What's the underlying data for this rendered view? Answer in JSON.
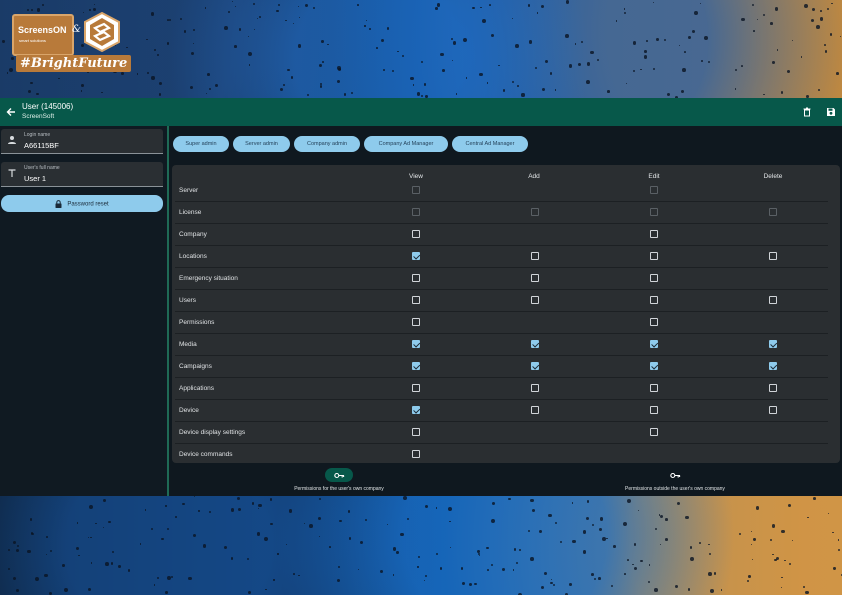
{
  "logo": {
    "brand": "ScreensON",
    "brand_sub": "smart solutions",
    "ampersand": "&",
    "tagline": "#BrightFuture"
  },
  "appbar": {
    "title": "User (145006)",
    "subtitle": "ScreenSoft"
  },
  "sidebar": {
    "login": {
      "label": "Login name",
      "value": "A66115BF"
    },
    "fullname": {
      "label": "User's full name",
      "value": "User 1"
    },
    "password_reset": "Password reset"
  },
  "roles": [
    "Super admin",
    "Server admin",
    "Company admin",
    "Company Ad Manager",
    "Central Ad Manager"
  ],
  "table": {
    "columns": [
      "View",
      "Add",
      "Edit",
      "Delete"
    ],
    "rows": [
      {
        "label": "Server",
        "cells": [
          "disabled",
          "none",
          "disabled",
          "none"
        ]
      },
      {
        "label": "License",
        "cells": [
          "disabled",
          "disabled",
          "disabled",
          "disabled"
        ]
      },
      {
        "label": "Company",
        "cells": [
          "unchecked",
          "none",
          "unchecked",
          "none"
        ]
      },
      {
        "label": "Locations",
        "cells": [
          "checked",
          "unchecked",
          "unchecked",
          "unchecked"
        ]
      },
      {
        "label": "Emergency situation",
        "cells": [
          "unchecked",
          "unchecked",
          "unchecked",
          "none"
        ]
      },
      {
        "label": "Users",
        "cells": [
          "unchecked",
          "unchecked",
          "unchecked",
          "unchecked"
        ]
      },
      {
        "label": "Permissions",
        "cells": [
          "unchecked",
          "none",
          "unchecked",
          "none"
        ]
      },
      {
        "label": "Media",
        "cells": [
          "checked",
          "checked",
          "checked",
          "checked"
        ]
      },
      {
        "label": "Campaigns",
        "cells": [
          "checked",
          "checked",
          "checked",
          "checked"
        ]
      },
      {
        "label": "Applications",
        "cells": [
          "unchecked",
          "unchecked",
          "unchecked",
          "unchecked"
        ]
      },
      {
        "label": "Device",
        "cells": [
          "checked",
          "unchecked",
          "unchecked",
          "unchecked"
        ]
      },
      {
        "label": "Device display settings",
        "cells": [
          "unchecked",
          "none",
          "unchecked",
          "none"
        ]
      },
      {
        "label": "Device commands",
        "cells": [
          "unchecked",
          "none",
          "none",
          "none"
        ]
      }
    ]
  },
  "bottom_nav": [
    {
      "label": "Permissions for the user's own company",
      "icon": "key-icon",
      "active": true
    },
    {
      "label": "Permissions outside the user's own company",
      "icon": "key-icon",
      "active": false
    }
  ],
  "colors": {
    "appbar": "#07584a",
    "chip": "#8ecbec",
    "checked": "#8ecbec",
    "card": "#2a2e31",
    "sidebar": "#101a22"
  }
}
